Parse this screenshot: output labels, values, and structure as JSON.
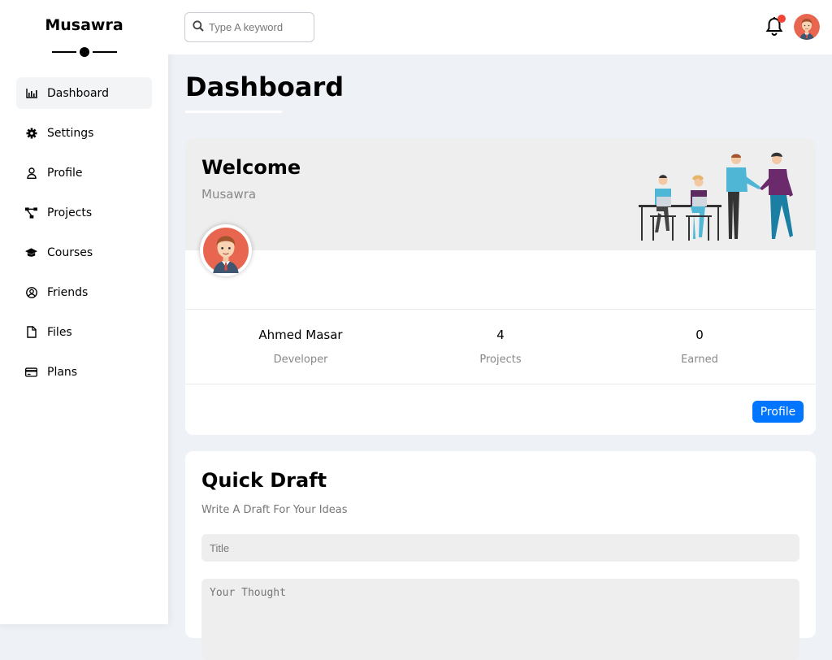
{
  "brand": {
    "name": "Musawra"
  },
  "sidebar": {
    "items": [
      {
        "label": "Dashboard",
        "icon": "chart-bar-icon",
        "active": true
      },
      {
        "label": "Settings",
        "icon": "gear-icon"
      },
      {
        "label": "Profile",
        "icon": "user-icon"
      },
      {
        "label": "Projects",
        "icon": "diagram-icon"
      },
      {
        "label": "Courses",
        "icon": "graduation-cap-icon"
      },
      {
        "label": "Friends",
        "icon": "user-circle-icon"
      },
      {
        "label": "Files",
        "icon": "file-icon"
      },
      {
        "label": "Plans",
        "icon": "credit-card-icon"
      }
    ]
  },
  "header": {
    "search_placeholder": "Type A keyword",
    "notification_dot_color": "#f44336"
  },
  "page": {
    "title": "Dashboard"
  },
  "welcome": {
    "title": "Welcome",
    "subtitle": "Musawra",
    "stats": [
      {
        "value": "Ahmed Masar",
        "label": "Developer"
      },
      {
        "value": "4",
        "label": "Projects"
      },
      {
        "value": "0",
        "label": "Earned"
      }
    ],
    "profile_button": "Profile"
  },
  "draft": {
    "title": "Quick Draft",
    "subtitle": "Write A Draft For Your Ideas",
    "title_placeholder": "Title",
    "thought_placeholder": "Your Thought"
  },
  "colors": {
    "accent": "#0075ff",
    "background": "#eef1f5"
  }
}
